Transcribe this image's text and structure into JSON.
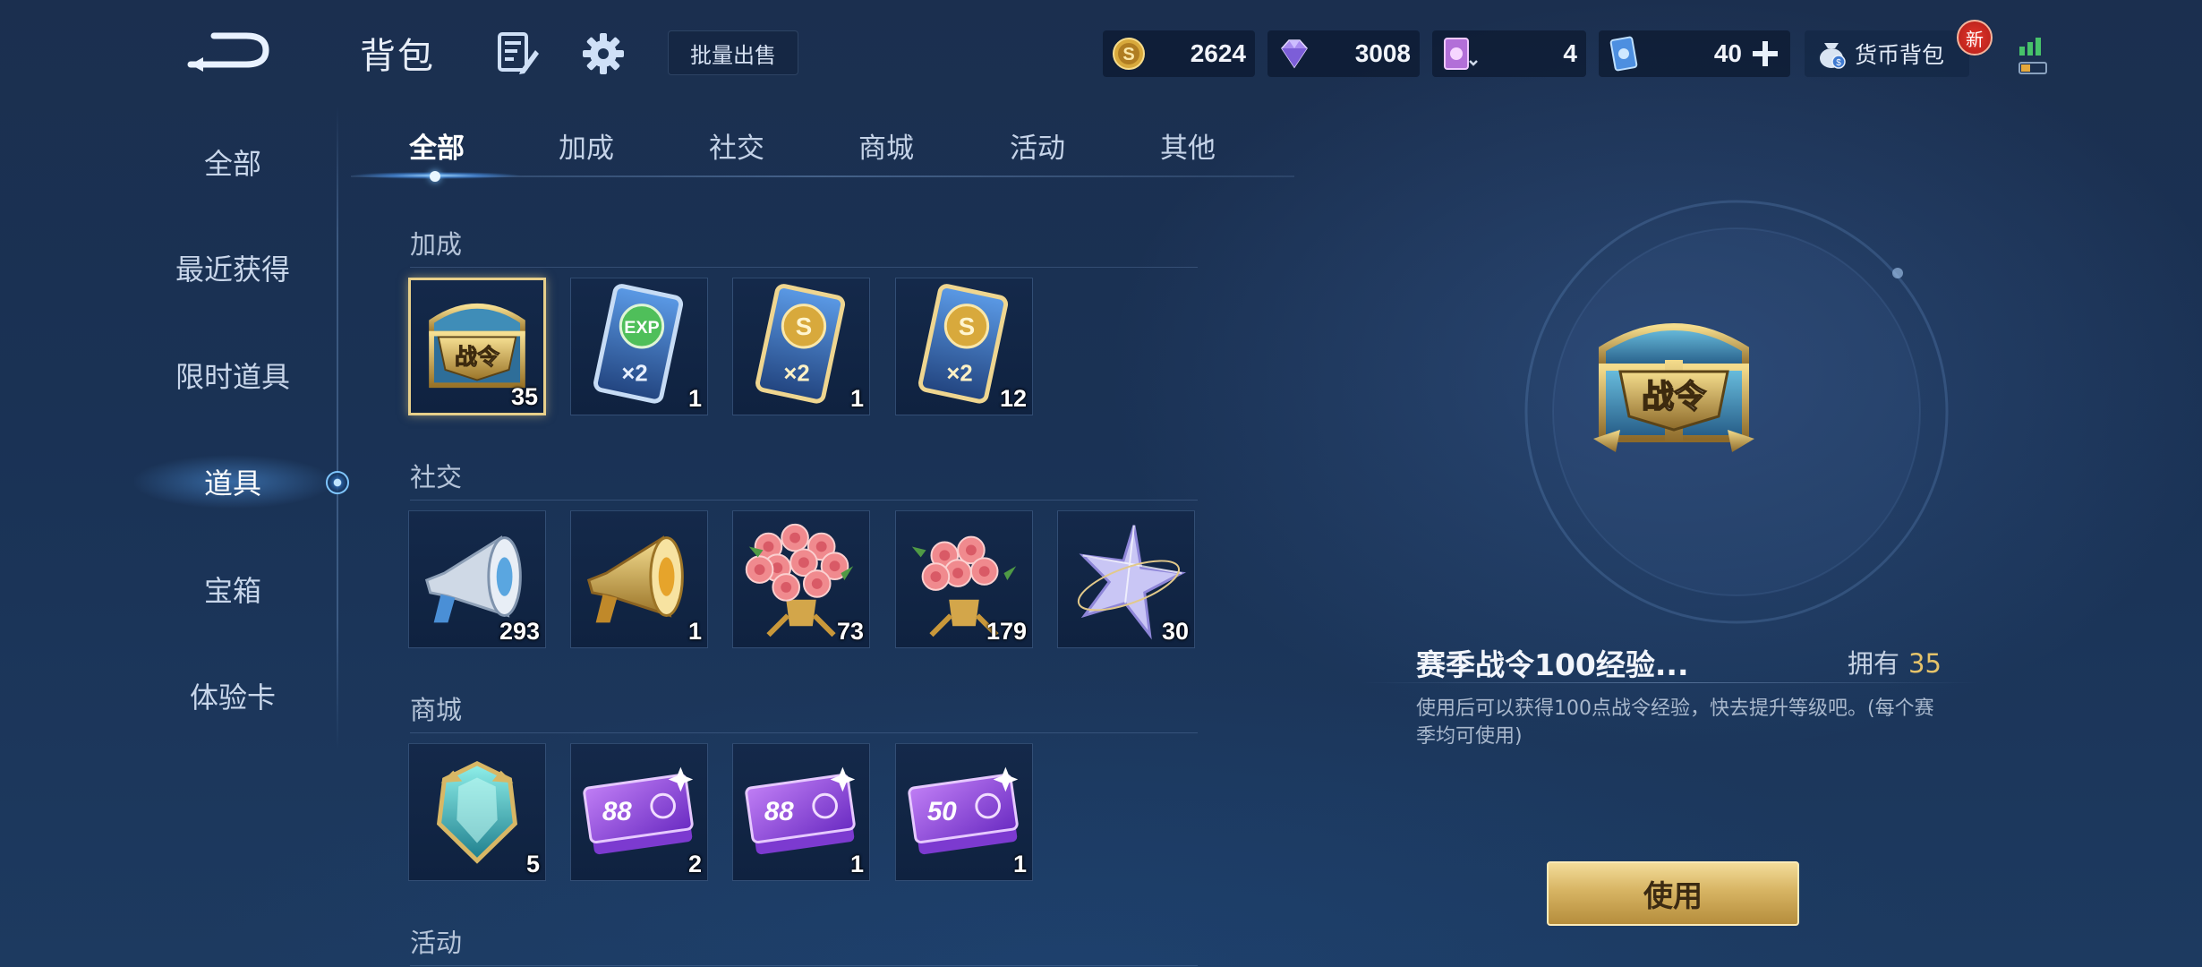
{
  "header": {
    "title": "背包",
    "batch_sell_label": "批量出售",
    "currencies": {
      "gold": "2624",
      "gem": "3008",
      "card": "4",
      "ticket": "40"
    },
    "wallet_label": "货币背包",
    "new_badge": "新"
  },
  "sidebar": {
    "items": [
      {
        "label": "全部"
      },
      {
        "label": "最近获得"
      },
      {
        "label": "限时道具"
      },
      {
        "label": "道具"
      },
      {
        "label": "宝箱"
      },
      {
        "label": "体验卡"
      }
    ],
    "active_index": 3
  },
  "tabs": {
    "items": [
      {
        "label": "全部"
      },
      {
        "label": "加成"
      },
      {
        "label": "社交"
      },
      {
        "label": "商城"
      },
      {
        "label": "活动"
      },
      {
        "label": "其他"
      }
    ],
    "active_index": 0
  },
  "sections": [
    {
      "label": "加成",
      "items": [
        {
          "icon": "battle-pass-chest-icon",
          "count": "35",
          "selected": true
        },
        {
          "icon": "exp-double-card-icon",
          "count": "1"
        },
        {
          "icon": "gold-double-card-icon",
          "count": "1"
        },
        {
          "icon": "gold-double-card-icon",
          "count": "12"
        }
      ]
    },
    {
      "label": "社交",
      "items": [
        {
          "icon": "silver-megaphone-icon",
          "count": "293"
        },
        {
          "icon": "gold-megaphone-icon",
          "count": "1"
        },
        {
          "icon": "rose-bouquet-large-icon",
          "count": "73"
        },
        {
          "icon": "rose-bouquet-icon",
          "count": "179"
        },
        {
          "icon": "crystal-star-icon",
          "count": "30"
        }
      ]
    },
    {
      "label": "商城",
      "items": [
        {
          "icon": "teal-crystal-badge-icon",
          "count": "5"
        },
        {
          "icon": "purple-coupon-88-icon",
          "count": "2",
          "coupon": "88"
        },
        {
          "icon": "purple-coupon-88-icon",
          "count": "1",
          "coupon": "88"
        },
        {
          "icon": "purple-coupon-50-icon",
          "count": "1",
          "coupon": "50"
        }
      ]
    },
    {
      "label": "活动",
      "items": []
    }
  ],
  "detail": {
    "title": "赛季战令100经验...",
    "own_label": "拥有",
    "own_count": "35",
    "description": "使用后可以获得100点战令经验，快去提升等级吧。(每个赛季均可使用)",
    "use_label": "使用",
    "chest_text": "战令"
  },
  "colors": {
    "accent_gold": "#e5c36a",
    "selection_border": "#e7cf8a",
    "background": "#1a3255"
  }
}
